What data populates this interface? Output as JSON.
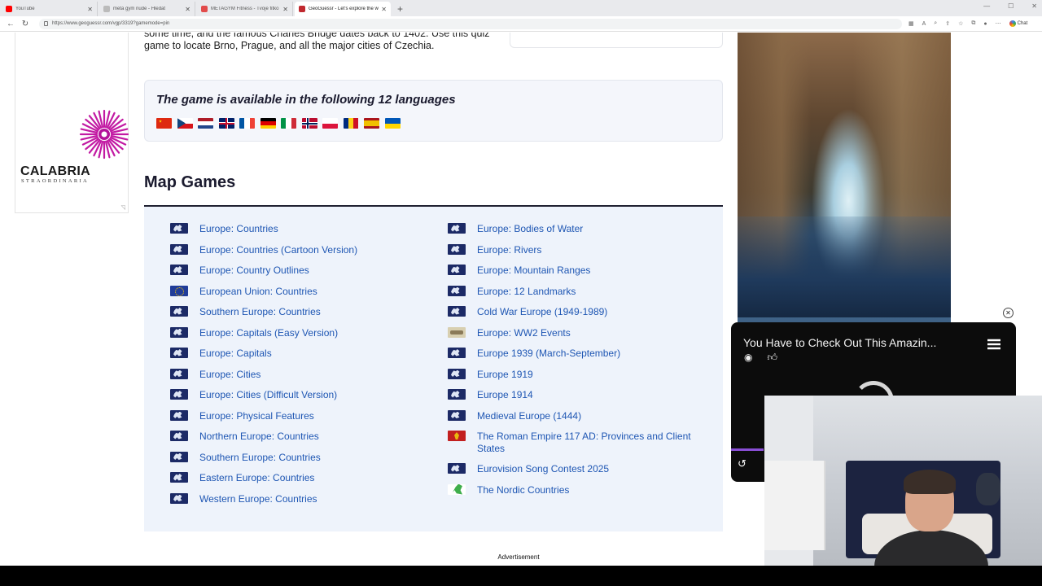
{
  "browser": {
    "tabs": [
      {
        "title": "YouTube",
        "fav_color": "#ff0000",
        "active": false
      },
      {
        "title": "meta gym nude - Hledat",
        "fav_color": "#bbbbbb",
        "active": false
      },
      {
        "title": "METAGYM Fitness - Tvoje fitko za",
        "fav_color": "#e24b4b",
        "active": false
      },
      {
        "title": "GeoGuessr - Let's explore the wor",
        "fav_color": "#c0282e",
        "active": true
      }
    ],
    "url": "https://www.geoguessr.com/vgp/3319?gamemode=pin",
    "chat_label": "Chat"
  },
  "intro": {
    "line1": "some time, and the famous Charles Bridge dates back to 1402. Use this quiz",
    "line2": "game to locate Brno, Prague, and all the major cities of Czechia."
  },
  "languages": {
    "title": "The game is available in the following 12 languages",
    "flags": [
      "china-flag",
      "czech-flag",
      "dutch-flag",
      "uk-flag",
      "french-flag",
      "german-flag",
      "italian-flag",
      "norwegian-flag",
      "polish-flag",
      "romanian-flag",
      "spanish-flag",
      "ukrainian-flag"
    ]
  },
  "map_games": {
    "title": "Map Games",
    "left": [
      {
        "label": "Europe: Countries",
        "icon": "eu-map"
      },
      {
        "label": "Europe: Countries (Cartoon Version)",
        "icon": "eu-map"
      },
      {
        "label": "Europe: Country Outlines",
        "icon": "eu-map"
      },
      {
        "label": "European Union: Countries",
        "icon": "eu-flag"
      },
      {
        "label": "Southern Europe: Countries",
        "icon": "eu-map"
      },
      {
        "label": "Europe: Capitals (Easy Version)",
        "icon": "eu-map"
      },
      {
        "label": "Europe: Capitals",
        "icon": "eu-map"
      },
      {
        "label": "Europe: Cities",
        "icon": "eu-map"
      },
      {
        "label": "Europe: Cities (Difficult Version)",
        "icon": "eu-map"
      },
      {
        "label": "Europe: Physical Features",
        "icon": "eu-map"
      },
      {
        "label": "Northern Europe: Countries",
        "icon": "eu-map"
      },
      {
        "label": "Southern Europe: Countries",
        "icon": "eu-map"
      },
      {
        "label": "Eastern Europe: Countries",
        "icon": "eu-map"
      },
      {
        "label": "Western Europe: Countries",
        "icon": "eu-map"
      }
    ],
    "right": [
      {
        "label": "Europe: Bodies of Water",
        "icon": "eu-map"
      },
      {
        "label": "Europe: Rivers",
        "icon": "eu-map"
      },
      {
        "label": "Europe: Mountain Ranges",
        "icon": "eu-map"
      },
      {
        "label": "Europe: 12 Landmarks",
        "icon": "eu-map"
      },
      {
        "label": "Cold War Europe (1949-1989)",
        "icon": "eu-map"
      },
      {
        "label": "Europe: WW2 Events",
        "icon": "ww2"
      },
      {
        "label": "Europe 1939 (March-September)",
        "icon": "eu-map"
      },
      {
        "label": "Europe 1919",
        "icon": "eu-map"
      },
      {
        "label": "Europe 1914",
        "icon": "eu-map"
      },
      {
        "label": "Medieval Europe (1444)",
        "icon": "eu-map"
      },
      {
        "label": "The Roman Empire 117 AD: Provinces and Client States",
        "icon": "rome"
      },
      {
        "label": "Eurovision Song Contest 2025",
        "icon": "eu-map"
      },
      {
        "label": "The Nordic Countries",
        "icon": "nordic"
      }
    ]
  },
  "ads": {
    "left_brand": "CALABRIA",
    "left_tagline": "STRAORDINARIA",
    "advertisement_label": "Advertisement"
  },
  "video": {
    "title": "You Have to Check Out This Amazin..."
  }
}
